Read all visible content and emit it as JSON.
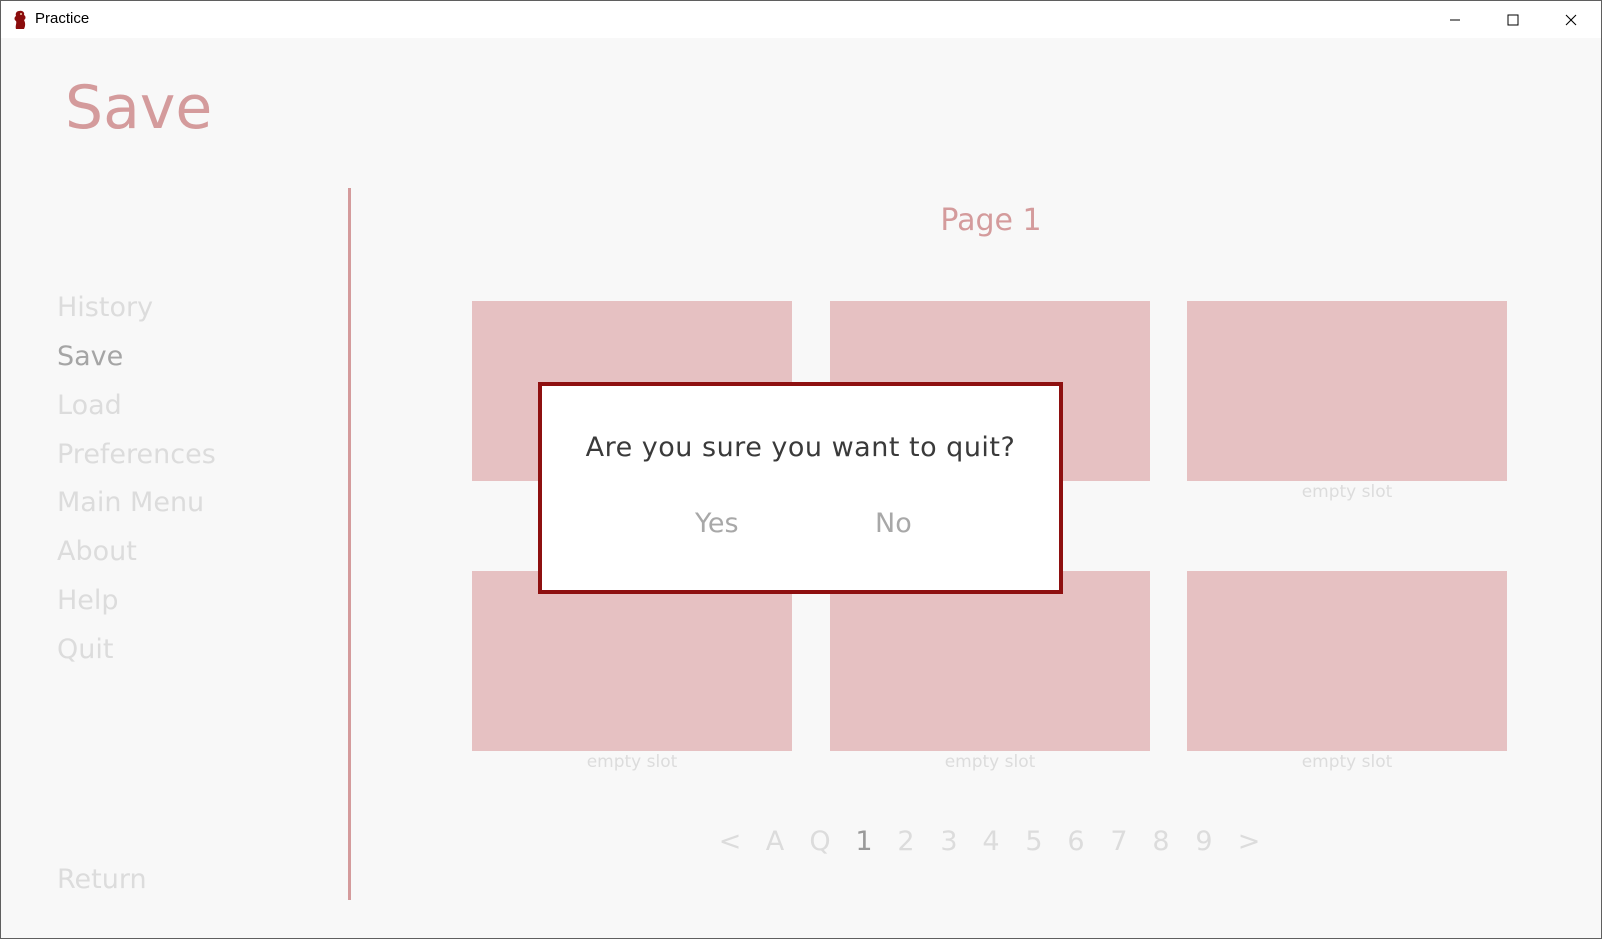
{
  "window": {
    "title": "Practice",
    "icon": "app-character-icon",
    "controls": [
      "minimize-icon",
      "maximize-icon",
      "close-icon"
    ]
  },
  "screen": {
    "title": "Save",
    "page_label": "Page 1"
  },
  "nav": {
    "items": [
      {
        "label": "History",
        "active": false
      },
      {
        "label": "Save",
        "active": true
      },
      {
        "label": "Load",
        "active": false
      },
      {
        "label": "Preferences",
        "active": false
      },
      {
        "label": "Main Menu",
        "active": false
      },
      {
        "label": "About",
        "active": false
      },
      {
        "label": "Help",
        "active": false
      },
      {
        "label": "Quit",
        "active": false
      }
    ],
    "return_label": "Return"
  },
  "slots": [
    {
      "label": "empty slot"
    },
    {
      "label": "empty slot"
    },
    {
      "label": "empty slot"
    },
    {
      "label": "empty slot"
    },
    {
      "label": "empty slot"
    },
    {
      "label": "empty slot"
    }
  ],
  "pager": {
    "items": [
      "<",
      "A",
      "Q",
      "1",
      "2",
      "3",
      "4",
      "5",
      "6",
      "7",
      "8",
      "9",
      ">"
    ],
    "current": "1"
  },
  "modal": {
    "message": "Are you sure you want to quit?",
    "yes_label": "Yes",
    "no_label": "No"
  },
  "colors": {
    "accent": "#d49b9c",
    "slot_fill": "#e6c1c2",
    "modal_border": "#8e1010",
    "background": "#f8f8f8"
  }
}
